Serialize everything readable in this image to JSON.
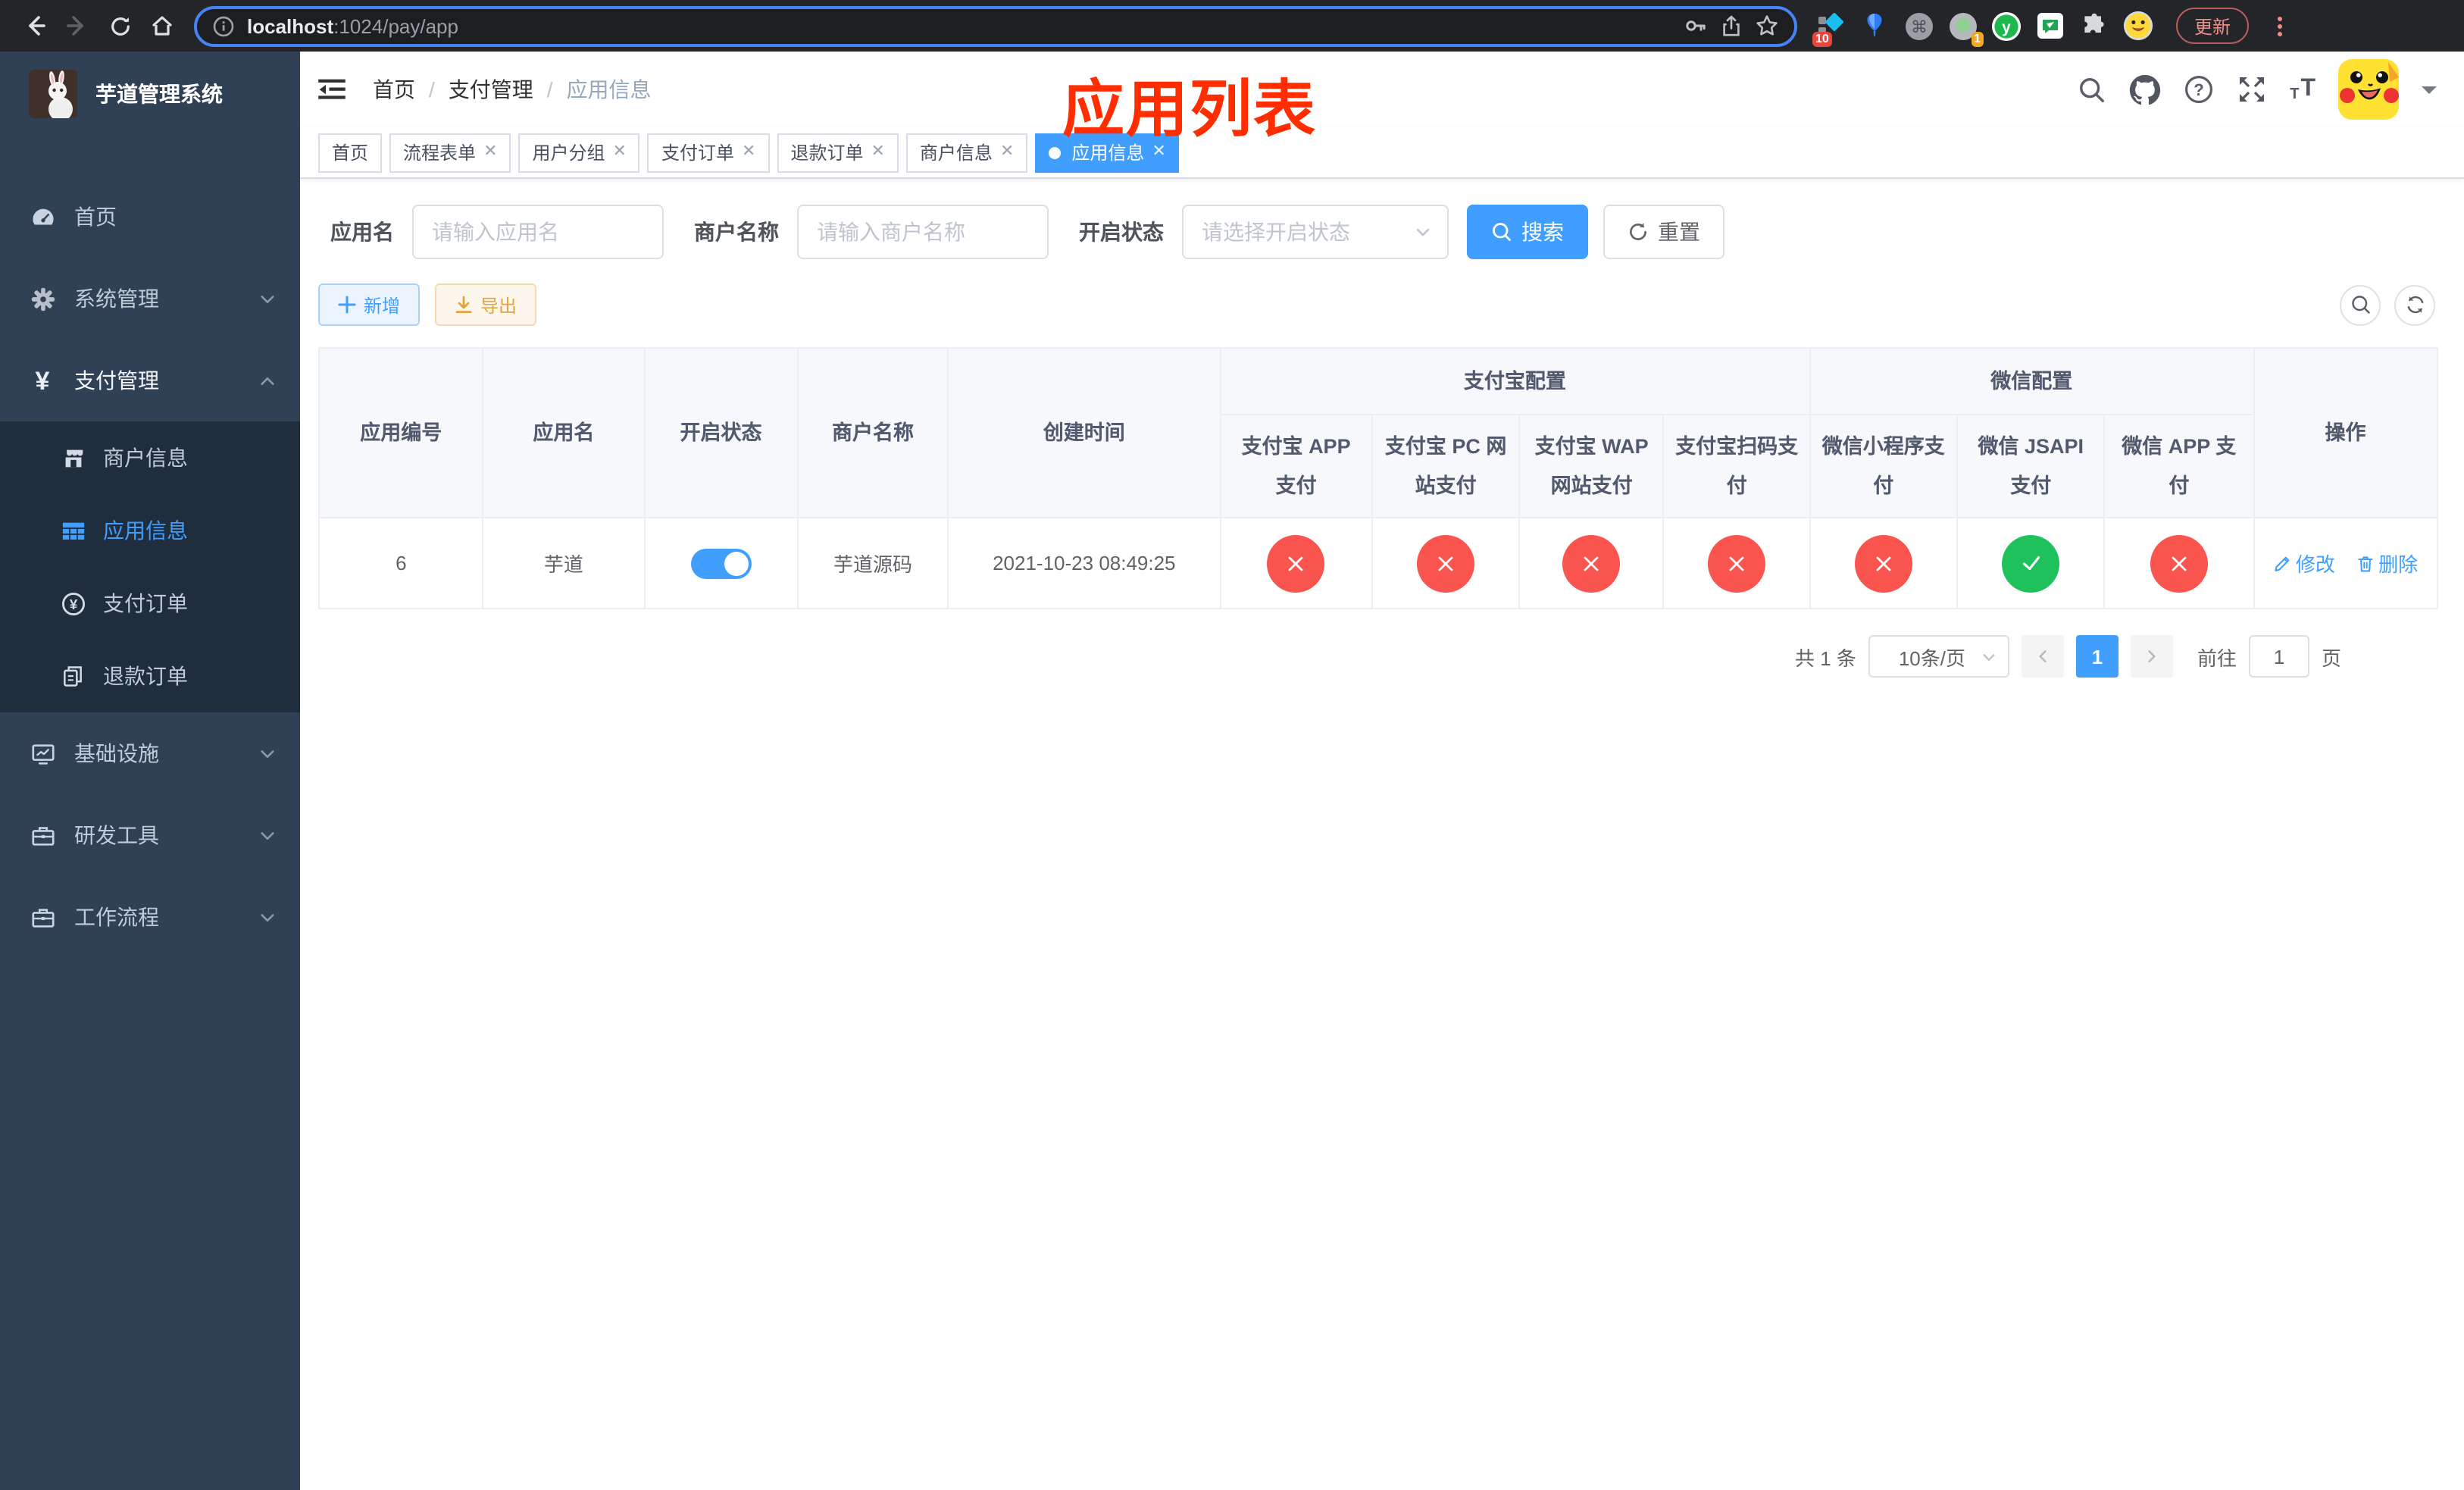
{
  "browser": {
    "url_host": "localhost",
    "url_rest": ":1024/pay/app",
    "update_label": "更新",
    "ext_badge_diamond": "10",
    "ext_badge_circle": "1"
  },
  "sidebar": {
    "title": "芋道管理系统",
    "items": {
      "home": "首页",
      "system": "系统管理",
      "payment": "支付管理",
      "infra": "基础设施",
      "devtools": "研发工具",
      "workflow": "工作流程"
    },
    "payment_children": {
      "merchant": "商户信息",
      "app": "应用信息",
      "pay_order": "支付订单",
      "refund_order": "退款订单"
    }
  },
  "navbar": {
    "breadcrumb": [
      "首页",
      "支付管理",
      "应用信息"
    ]
  },
  "annotation": "应用列表",
  "tabs": [
    {
      "label": "首页",
      "closable": false,
      "active": false
    },
    {
      "label": "流程表单",
      "closable": true,
      "active": false
    },
    {
      "label": "用户分组",
      "closable": true,
      "active": false
    },
    {
      "label": "支付订单",
      "closable": true,
      "active": false
    },
    {
      "label": "退款订单",
      "closable": true,
      "active": false
    },
    {
      "label": "商户信息",
      "closable": true,
      "active": false
    },
    {
      "label": "应用信息",
      "closable": true,
      "active": true
    }
  ],
  "filters": {
    "app_name_label": "应用名",
    "app_name_placeholder": "请输入应用名",
    "merchant_label": "商户名称",
    "merchant_placeholder": "请输入商户名称",
    "status_label": "开启状态",
    "status_placeholder": "请选择开启状态",
    "search_label": "搜索",
    "reset_label": "重置"
  },
  "toolbar": {
    "add_label": "新增",
    "export_label": "导出"
  },
  "table": {
    "groups": {
      "alipay": "支付宝配置",
      "wechat": "微信配置"
    },
    "columns": {
      "id": "应用编号",
      "name": "应用名",
      "enabled": "开启状态",
      "merchant": "商户名称",
      "created": "创建时间",
      "alipay_app": "支付宝 APP 支付",
      "alipay_pc": "支付宝 PC 网站支付",
      "alipay_wap": "支付宝 WAP 网站支付",
      "alipay_qr": "支付宝扫码支付",
      "wx_lite": "微信小程序支付",
      "wx_jsapi": "微信 JSAPI 支付",
      "wx_app": "微信 APP 支付",
      "ops": "操作"
    },
    "row": {
      "id": "6",
      "name": "芋道",
      "enabled": true,
      "merchant": "芋道源码",
      "created": "2021-10-23 08:49:25",
      "configs": {
        "alipay_app": false,
        "alipay_pc": false,
        "alipay_wap": false,
        "alipay_qr": false,
        "wx_lite": false,
        "wx_jsapi": true,
        "wx_app": false
      },
      "edit_label": "修改",
      "delete_label": "删除"
    }
  },
  "pagination": {
    "total_text": "共 1 条",
    "page_size": "10条/页",
    "current_page": "1",
    "goto_label": "前往",
    "goto_value": "1",
    "page_unit": "页"
  },
  "colors": {
    "primary": "#409eff",
    "danger": "#f9544e",
    "success": "#1ec15b",
    "warning": "#e6a23c",
    "sidebar_bg": "#304156",
    "submenu_bg": "#1f2d3d"
  }
}
